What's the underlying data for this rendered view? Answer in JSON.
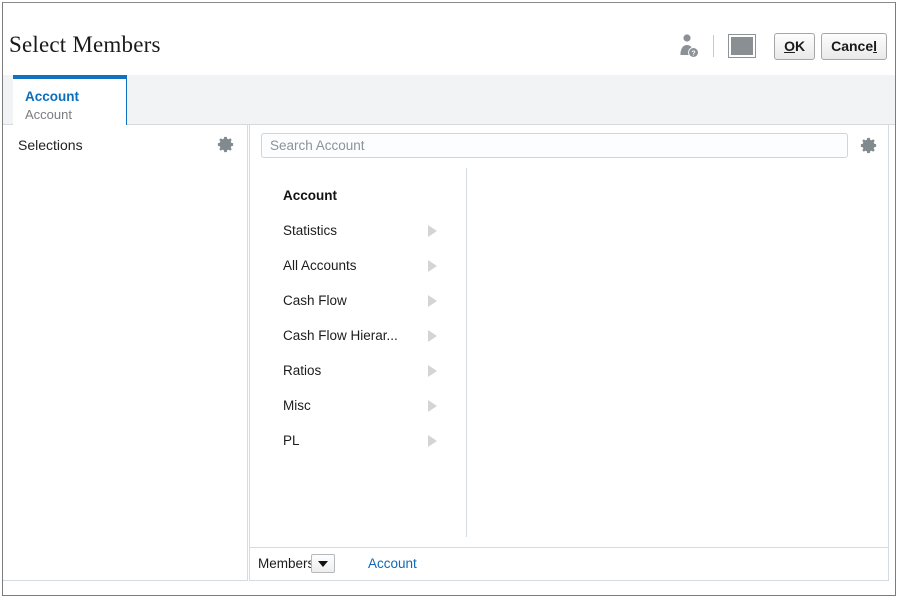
{
  "window": {
    "title": "Select Members"
  },
  "title_actions": {
    "help_user_icon": "person-help-icon",
    "swatch_button_name": "restore-square-button",
    "ok_label_prefix": "",
    "ok_label_accel": "O",
    "ok_label_rest": "K",
    "ok_label": "OK",
    "cancel_label_start": "Cance",
    "cancel_label_accel": "l",
    "cancel_label": "Cancel"
  },
  "tabs": [
    {
      "title": "Account",
      "subtitle": "Account",
      "selected": true
    }
  ],
  "left_panel": {
    "header_label": "Selections",
    "gear_icon": "gear-icon",
    "items": []
  },
  "search": {
    "placeholder": "Search Account",
    "value": "",
    "gear_icon": "gear-icon"
  },
  "members": {
    "rows": [
      {
        "label": "Account",
        "root": true,
        "has_children": false
      },
      {
        "label": "Statistics",
        "root": false,
        "has_children": true
      },
      {
        "label": "All Accounts",
        "root": false,
        "has_children": true
      },
      {
        "label": "Cash Flow",
        "root": false,
        "has_children": true
      },
      {
        "label": "Cash Flow Hierar...",
        "root": false,
        "has_children": true
      },
      {
        "label": "Ratios",
        "root": false,
        "has_children": true
      },
      {
        "label": "Misc",
        "root": false,
        "has_children": true
      },
      {
        "label": "PL",
        "root": false,
        "has_children": true
      }
    ]
  },
  "footer": {
    "members_label": "Members",
    "dropdown_icon": "chevron-down-icon",
    "breadcrumb": "Account"
  },
  "colors": {
    "accent_blue": "#0a6ebd",
    "tab_border_blue": "#1270c0",
    "link_blue": "#1068b5",
    "panel_border": "#d3dce3",
    "tabstrip_bg": "#f2f3f4",
    "muted_text": "#7a7d80",
    "arrow_gray": "#d2d4d6"
  }
}
